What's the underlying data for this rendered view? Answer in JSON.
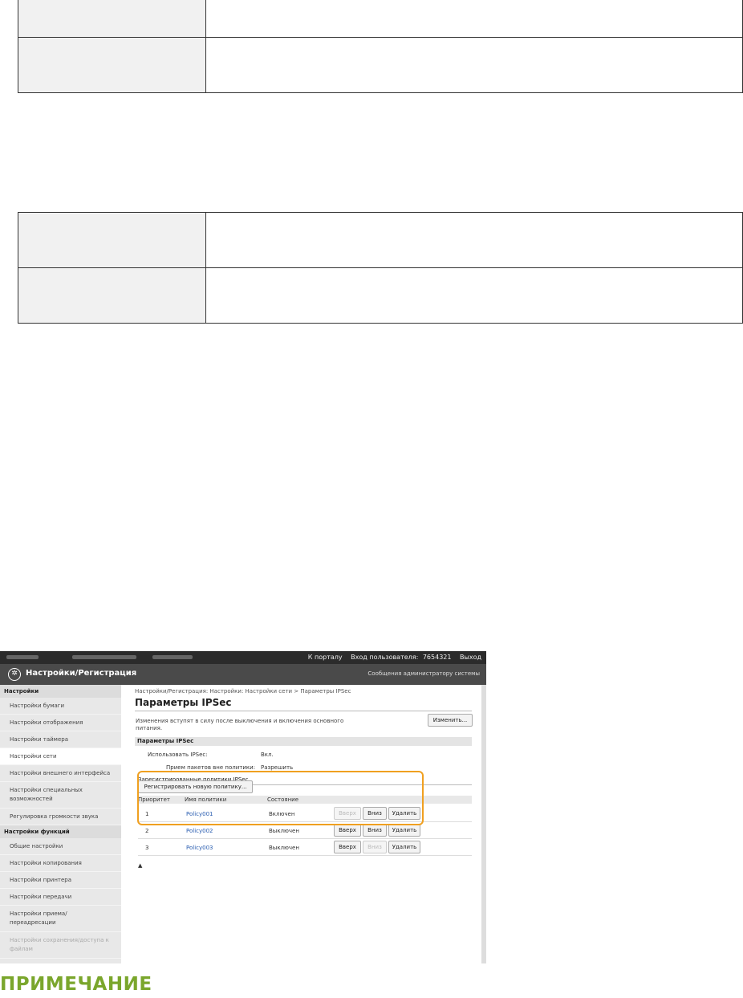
{
  "screenshot": {
    "topbar": {
      "portal_link": "К порталу",
      "login_label": "Вход пользователя:",
      "user_id": "7654321",
      "logout_link": "Выход"
    },
    "header": {
      "title": "Настройки/Регистрация",
      "admin_message_link": "Сообщения администратору системы"
    },
    "sidebar": {
      "section_settings": "Настройки",
      "items_settings": [
        "Настройки бумаги",
        "Настройки отображения",
        "Настройки таймера",
        "Настройки сети",
        "Настройки внешнего интерфейса",
        "Настройки специальных возможностей",
        "Регулировка громкости звука"
      ],
      "section_functions": "Настройки функций",
      "items_functions": [
        "Общие настройки",
        "Настройки копирования",
        "Настройки принтера",
        "Настройки передачи",
        "Настройки приема/переадресации",
        "Настройки сохранения/доступа к файлам"
      ]
    },
    "main": {
      "breadcrumb": "Настройки/Регистрация: Настройки: Настройки сети > Параметры IPSec",
      "page_title": "Параметры IPSec",
      "note_line1": "Изменения вступят в силу после выключения и включения основного",
      "note_line2": "питания.",
      "edit_button": "Изменить...",
      "section_title": "Параметры IPSec",
      "use_ipsec_label": "Использовать IPSec:",
      "use_ipsec_value": "Вкл.",
      "packets_label": "Прием пакетов вне политики:",
      "packets_value": "Разрешить",
      "registered_title": "Зарегистрированные политики IPSec",
      "register_button": "Регистрировать новую политику...",
      "columns": {
        "priority": "Приоритет",
        "policy_name": "Имя политики",
        "status": "Состояние"
      },
      "rows": [
        {
          "priority": "1",
          "name": "Policy001",
          "status": "Включен"
        },
        {
          "priority": "2",
          "name": "Policy002",
          "status": "Выключен"
        },
        {
          "priority": "3",
          "name": "Policy003",
          "status": "Выключен"
        }
      ],
      "up_label": "Вверх",
      "down_label": "Вниз",
      "delete_label": "Удалить",
      "to_top": "▲"
    }
  },
  "note_heading": "ПРИМЕЧАНИЕ"
}
